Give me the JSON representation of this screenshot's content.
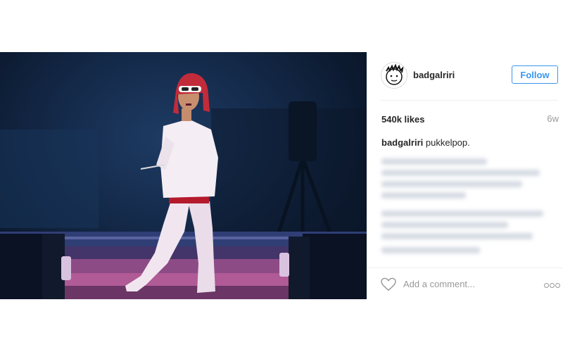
{
  "post": {
    "image": {
      "alt": "",
      "icon": "photo"
    },
    "author": {
      "username": "badgalriri",
      "avatar_icon": "avatar-face-icon"
    },
    "follow_label": "Follow",
    "likes": "540k likes",
    "time_ago": "6w",
    "caption": {
      "username": "badgalriri",
      "text": "pukkelpop."
    },
    "comment_input": {
      "placeholder": "Add a comment..."
    },
    "icons": {
      "like": "heart-icon",
      "more": "more-options-icon"
    },
    "colors": {
      "accent": "#3897f0",
      "text": "#262626",
      "muted": "#999999"
    }
  }
}
